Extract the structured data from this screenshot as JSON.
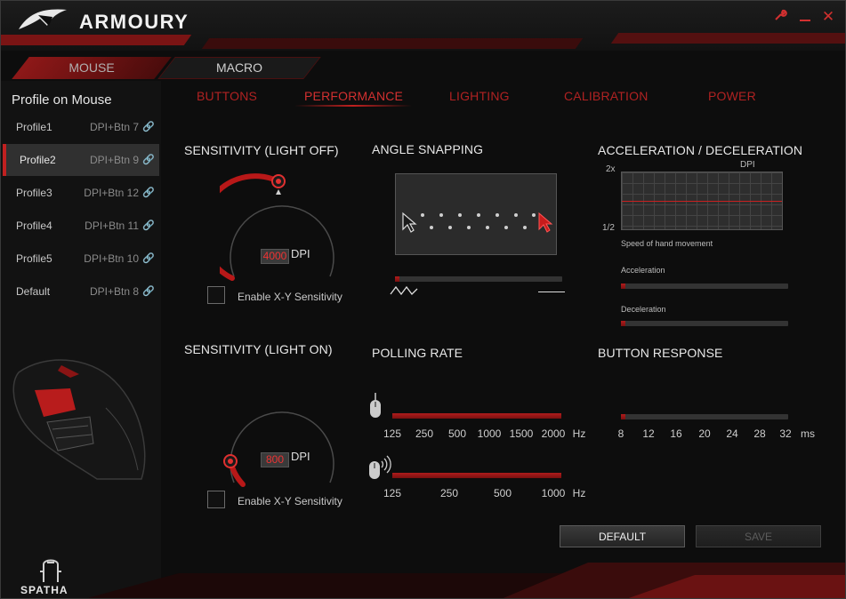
{
  "window": {
    "title": "ARMOURY",
    "controls": [
      "wrench-icon",
      "minimize-icon",
      "close-icon"
    ]
  },
  "tabs": {
    "mouse": "MOUSE",
    "macro": "MACRO"
  },
  "sidebar": {
    "heading": "Profile on Mouse",
    "profiles": [
      {
        "name": "Profile1",
        "binding": "DPI+Btn 7",
        "active": false
      },
      {
        "name": "Profile2",
        "binding": "DPI+Btn 9",
        "active": true
      },
      {
        "name": "Profile3",
        "binding": "DPI+Btn 12",
        "active": false
      },
      {
        "name": "Profile4",
        "binding": "DPI+Btn 11",
        "active": false
      },
      {
        "name": "Profile5",
        "binding": "DPI+Btn 10",
        "active": false
      },
      {
        "name": "Default",
        "binding": "DPI+Btn 8",
        "active": false
      }
    ],
    "device_name": "SPATHA"
  },
  "subtabs": {
    "buttons": "BUTTONS",
    "performance": "PERFORMANCE",
    "lighting": "LIGHTING",
    "calibration": "CALIBRATION",
    "power": "POWER"
  },
  "sensitivity_off": {
    "title": "SENSITIVITY (LIGHT OFF)",
    "dpi": "4000",
    "unit": "DPI",
    "xy_label": "Enable X-Y Sensitivity"
  },
  "sensitivity_on": {
    "title": "SENSITIVITY (LIGHT ON)",
    "dpi": "800",
    "unit": "DPI",
    "xy_label": "Enable X-Y Sensitivity"
  },
  "angle_snapping": {
    "title": "ANGLE  SNAPPING"
  },
  "accel": {
    "title": "ACCELERATION / DECELERATION",
    "graph_top": "2x",
    "graph_bottom": "1/2",
    "graph_unit": "DPI",
    "graph_xlabel": "Speed of hand movement",
    "acceleration_label": "Acceleration",
    "deceleration_label": "Deceleration"
  },
  "polling": {
    "title": "POLLING RATE",
    "wired_ticks": [
      "125",
      "250",
      "500",
      "1000",
      "1500",
      "2000"
    ],
    "wired_unit": "Hz",
    "wireless_ticks": [
      "125",
      "250",
      "500",
      "1000"
    ],
    "wireless_unit": "Hz",
    "wired_level": 1.0,
    "wireless_level": 1.0
  },
  "button_response": {
    "title": "BUTTON RESPONSE",
    "ticks": [
      "8",
      "12",
      "16",
      "20",
      "24",
      "28",
      "32"
    ],
    "unit": "ms"
  },
  "actions": {
    "default": "DEFAULT",
    "save": "SAVE"
  },
  "colors": {
    "accent": "#c0201f",
    "background": "#0d0d0d"
  }
}
